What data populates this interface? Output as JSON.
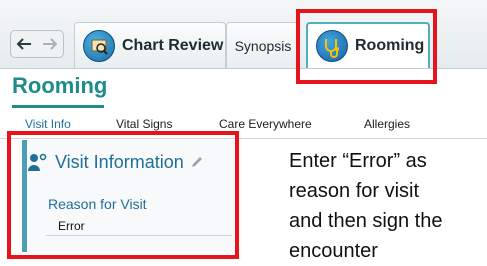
{
  "tabs": {
    "chart_review": "Chart Review",
    "synopsis": "Synopsis",
    "rooming": "Rooming"
  },
  "activity": {
    "title": "Rooming",
    "subnav": [
      "Visit Info",
      "Vital Signs",
      "Care Everywhere",
      "Allergies"
    ]
  },
  "section": {
    "title": "Visit Information",
    "field_label": "Reason for Visit",
    "field_value": "Error"
  },
  "instruction": "Enter “Error” as\nreason for visit\nand then sign the\nencounter",
  "colors": {
    "accent": "#1f8c8c",
    "link": "#1f6f9a",
    "highlight": "#e8141b"
  },
  "icons": {
    "back": "back-arrow-icon",
    "forward": "forward-arrow-icon",
    "chart_review": "chart-review-icon",
    "rooming": "stethoscope-icon",
    "visit_info": "visit-info-icon",
    "edit": "pencil-icon"
  }
}
